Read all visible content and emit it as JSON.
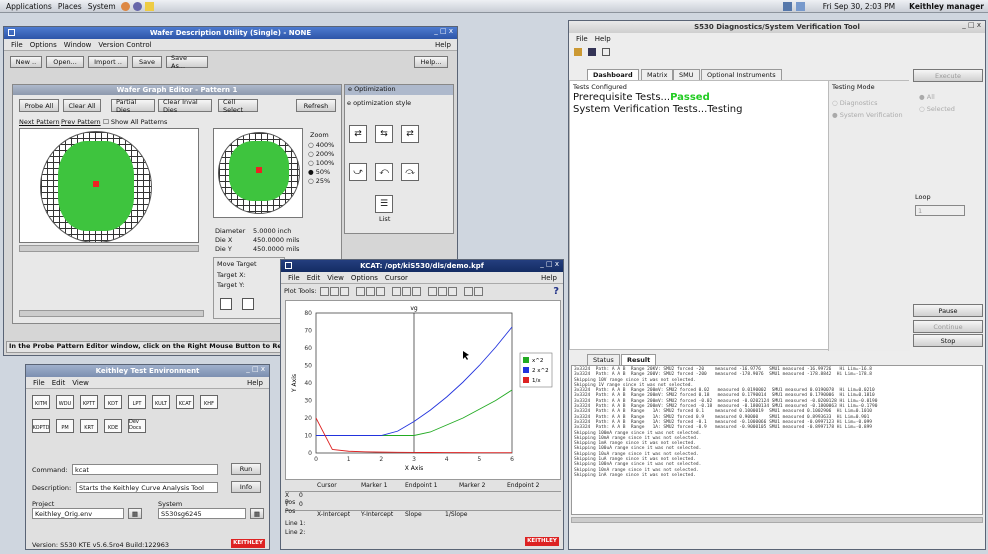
{
  "topbar": {
    "applications": "Applications",
    "places": "Places",
    "system": "System",
    "datetime": "Fri Sep 30, 2:03 PM",
    "user": "Keithley manager"
  },
  "wdu": {
    "title": "Wafer Description Utility (Single) - NONE",
    "menu": [
      "File",
      "Options",
      "Window",
      "Version Control"
    ],
    "help": "Help",
    "toolbar": [
      "New ..",
      "Open...",
      "Import ..",
      "Save",
      "Save As..."
    ],
    "help_button": "Help...",
    "status": "In the Probe Pattern Editor window, click on the Right Mouse Button to Re"
  },
  "wge": {
    "title": "Wafer Graph Editor - Pattern 1",
    "buttons": [
      "Probe All",
      "Clear All",
      "Partial Dies",
      "Clear Inval Dies",
      "Cell Select",
      "Refresh"
    ],
    "next": "Next Pattern",
    "prev": "Prev Pattern",
    "show_all": "Show All Patterns",
    "zoom": "Zoom",
    "zoom_levels": [
      "400%",
      "200%",
      "100%",
      "50%",
      "25%"
    ],
    "diameter_label": "Diameter",
    "diameter": "5.0000 inch",
    "diex_label": "Die X",
    "diex": "450.0000 mils",
    "diey_label": "Die Y",
    "diey": "450.0000 mils",
    "move_target": "Move Target",
    "target_x": "Target X:",
    "target_y": "Target Y:"
  },
  "opt": {
    "title": "e Optimization",
    "subtitle": "e optimization style",
    "list": "List"
  },
  "kcat": {
    "title": "KCAT: /opt/kiS530/dls/demo.kpf",
    "menu": [
      "File",
      "Edit",
      "View",
      "Options",
      "Cursor"
    ],
    "help": "Help",
    "plot_tools": "Plot Tools:",
    "cursor_headers": [
      "Cursor",
      "Marker 1",
      "Endpoint 1",
      "Marker 2",
      "Endpoint 2"
    ],
    "xpos": "X Pos",
    "xpos_val": "0",
    "ypos": "Y Pos",
    "ypos_val": "0",
    "line_headers": [
      "X-Intercept",
      "Y-Intercept",
      "Slope",
      "1/Slope"
    ],
    "line1": "Line 1:",
    "line2": "Line 2:",
    "logo": "KEITHLEY"
  },
  "chart_data": {
    "type": "line",
    "title": "vg",
    "xlabel": "X Axis",
    "ylabel": "Y Axis",
    "xlim": [
      0,
      6
    ],
    "ylim": [
      0,
      80
    ],
    "xticks": [
      0,
      1,
      2,
      3,
      4,
      5,
      6
    ],
    "yticks": [
      0,
      10,
      20,
      30,
      40,
      50,
      60,
      70,
      80
    ],
    "x": [
      0,
      0.5,
      1,
      1.5,
      2,
      2.5,
      3,
      3.5,
      4,
      4.5,
      5,
      5.5,
      6
    ],
    "series": [
      {
        "name": "x^2",
        "color": "#22aa22",
        "values": [
          10,
          10,
          10,
          10,
          10,
          10,
          10,
          12,
          16,
          20,
          25,
          30,
          36
        ]
      },
      {
        "name": "2 x^2",
        "color": "#2233dd",
        "values": [
          10,
          10,
          10,
          10,
          10,
          12.5,
          18,
          24.5,
          32,
          40.5,
          50,
          60.5,
          72
        ]
      },
      {
        "name": "1/x",
        "color": "#dd2222",
        "values": [
          20,
          2,
          1,
          0.67,
          0.5,
          0.4,
          0.33,
          0.29,
          0.25,
          0.22,
          0.2,
          0.18,
          0.17
        ]
      }
    ],
    "cursor_x": 3
  },
  "kte": {
    "title": "Keithley Test Environment",
    "menu": [
      "File",
      "Edit",
      "View"
    ],
    "help": "Help",
    "tools_row1": [
      "KITM",
      "WDU",
      "KPTT",
      "KDT",
      "LPT",
      "KULT",
      "KCAT",
      "KHF"
    ],
    "tools_row2": [
      "KOPTD",
      "PM",
      "KRT",
      "KDE",
      "Dev Docs"
    ],
    "command_label": "Command:",
    "command": "kcat",
    "run": "Run",
    "desc_label": "Description:",
    "desc": "Starts the Keithley Curve Analysis Tool",
    "info": "Info",
    "project_label": "Project",
    "project": "Keithley_Orig.env",
    "system_label": "System",
    "system": "S530sg6245",
    "version": "Version: S530 KTE v5.6.5ro4 Build:122963",
    "logo": "KEITHLEY"
  },
  "diag": {
    "title": "S530 Diagnostics/System Verification Tool",
    "menu": [
      "File",
      "Help"
    ],
    "tabs": [
      "Dashboard",
      "Matrix",
      "SMU",
      "Optional Instruments"
    ],
    "tests_configured": "Tests Configured",
    "line1_prefix": "Prerequisite Tests...",
    "line1_status": "Passed",
    "line2": "System Verification Tests...Testing",
    "testing_mode": "Testing Mode",
    "mode_diag": "Diagnostics",
    "mode_sysver": "System Verification",
    "execute": "Execute",
    "all": "All",
    "selected": "Selected",
    "loop": "Loop",
    "loop_val": "1",
    "pause": "Pause",
    "continue": "Continue",
    "stop": "Stop",
    "bottom_tabs": [
      "Status",
      "Result"
    ],
    "log": "3x3324  Path: A A B  Range 20KV: SMU2 forced -20    measured -16.9776   SMU1 measured -16.99726   Hi Lim=-16.8\n3x3324  Path: A A B  Range 200V: SMU2 forced -200   measured -178.9076  SMU1 measured -178.8842  Hi Lim=-178.8\nSkipping 10V range since it was not selected.\nSkipping 1V range since it was not selected.\n3x3324  Path: A A B  Range 200mV: SMU2 forced 0.02   measured 0.0190002  SMU1 measured 0.0190078  Hi Lim=0.0210\n3x3324  Path: A A B  Range 200mV: SMU2 forced 0.18   measured 0.1790014  SMU1 measured 0.1790006  Hi Lim=0.1810\n3x3324  Path: A A B  Range 200mV: SMU2 forced -0.02  measured -0.0202124 SMU1 measured -0.0200128 Hi Lim=-0.0190\n3x3324  Path: A A B  Range 200mV: SMU2 forced -0.18  measured -0.1800134 SMU1 measured -0.1800063 Hi Lim=-0.1790\n3x3324  Path: A A B  Range   1A: SMU2 forced 0.1    measured 0.1000019  SMU1 measured 0.1002906  Hi Lim=0.1010\n3x3324  Path: A A B  Range   1A: SMU2 forced 0.9    measured 0.90000    SMU1 measured 0.8993633  Hi Lim=0.901\n3x3324  Path: A A B  Range   1A: SMU2 forced -0.1   measured -0.1000066 SMU1 measured -0.0997123 Hi Lim=-0.099\n3x3324  Path: A A B  Range   1A: SMU2 forced -0.9   measured -0.9000105 SMU1 measured -0.8997178 Hi Lim=-0.899\nSkipping 100mA range since it was not selected.\nSkipping 10mA range since it was not selected.\nSkipping 1mA range since it was not selected.\nSkipping 100uA range since it was not selected.\nSkipping 10uA range since it was not selected.\nSkipping 1uA range since it was not selected.\nSkipping 100nA range since it was not selected.\nSkipping 10nA range since it was not selected.\nSkipping 1nA range since it was not selected."
  }
}
